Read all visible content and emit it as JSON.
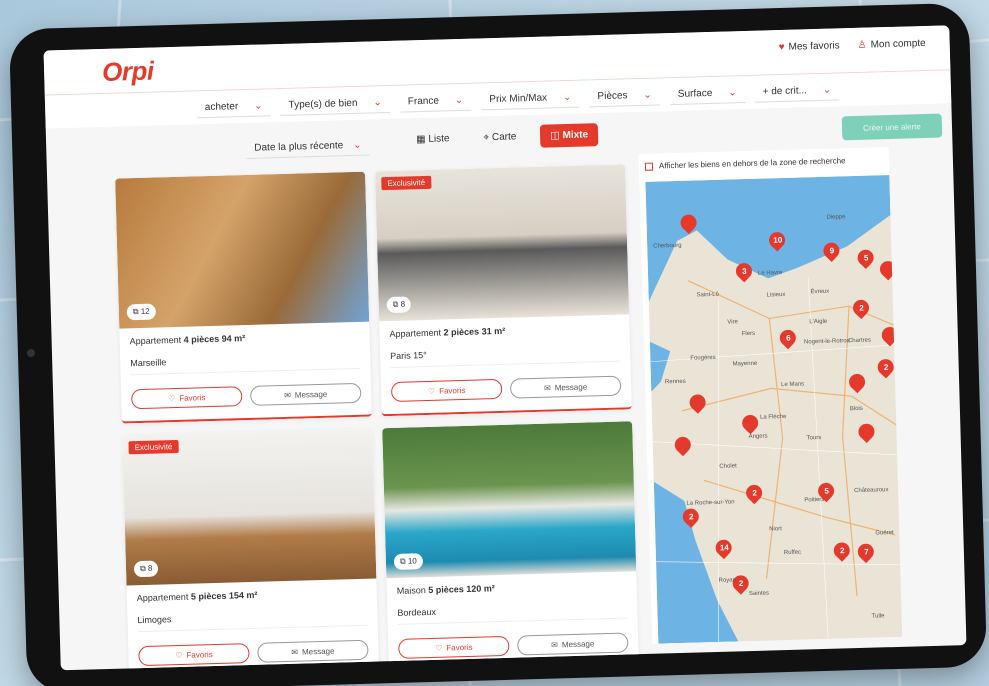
{
  "header": {
    "logo": "Orpi",
    "favorites": "Mes favoris",
    "account": "Mon compte"
  },
  "filters": [
    {
      "label": "acheter"
    },
    {
      "label": "Type(s) de bien"
    },
    {
      "label": "France"
    },
    {
      "label": "Prix Min/Max"
    },
    {
      "label": "Pièces"
    },
    {
      "label": "Surface"
    },
    {
      "label": "+ de crit..."
    }
  ],
  "toolbar": {
    "sort": "Date la plus récente",
    "view_list": "Liste",
    "view_map": "Carte",
    "view_mixed": "Mixte",
    "alert_button": "Créer une alerte"
  },
  "listings": [
    {
      "badge": "",
      "photos": "12",
      "type": "Appartement",
      "details": "4 pièces 94 m²",
      "city": "Marseille"
    },
    {
      "badge": "Exclusivité",
      "photos": "8",
      "type": "Appartement",
      "details": "2 pièces 31 m²",
      "city": "Paris 15°"
    },
    {
      "badge": "Exclusivité",
      "photos": "8",
      "type": "Appartement",
      "details": "5 pièces 154 m²",
      "city": "Limoges"
    },
    {
      "badge": "",
      "photos": "10",
      "type": "Maison",
      "details": "5 pièces 120 m²",
      "city": "Bordeaux"
    }
  ],
  "card_actions": {
    "favorite": "Favoris",
    "message": "Message"
  },
  "map": {
    "outside_zone": "Afficher les biens en dehors de la zone de recherche",
    "pins": [
      "",
      "10",
      "3",
      "9",
      "5",
      "",
      "2",
      "6",
      "",
      "2",
      "",
      "",
      "",
      "",
      "",
      "2",
      "5",
      "2",
      "14",
      "2",
      "7",
      "2"
    ],
    "labels": [
      "Cherbourg",
      "Dieppe",
      "Le Havre",
      "Saint-Lô",
      "Lisieux",
      "Évreux",
      "Vire",
      "Flers",
      "L'Aigle",
      "Chartres",
      "Nogent-le-Rotrou",
      "Fougères",
      "Mayenne",
      "Rennes",
      "Le Mans",
      "Blois",
      "La Flèche",
      "Angers",
      "Tours",
      "Cholet",
      "Châteauroux",
      "La Roche-sur-Yon",
      "Poitiers",
      "Niort",
      "Guéret",
      "Ruffec",
      "Royan",
      "Saintes",
      "Tulle"
    ]
  },
  "colors": {
    "brand": "#e5392b",
    "accent": "#7fd0b9"
  }
}
